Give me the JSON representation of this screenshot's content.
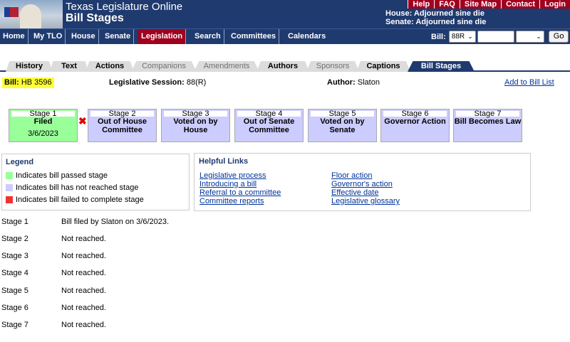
{
  "header": {
    "site_title": "Texas Legislature Online",
    "page_title": "Bill Stages",
    "top_links": [
      "Help",
      "FAQ",
      "Site Map",
      "Contact",
      "Login"
    ],
    "house_status": "House: Adjourned sine die",
    "senate_status": "Senate: Adjourned sine die"
  },
  "nav": {
    "items": [
      "Home",
      "My TLO",
      "House",
      "Senate",
      "Legislation",
      "Search",
      "Committees",
      "Calendars"
    ],
    "active": "Legislation",
    "bill_label": "Bill:",
    "session_value": "88R",
    "go_label": "Go"
  },
  "tabs": [
    "History",
    "Text",
    "Actions",
    "Companions",
    "Amendments",
    "Authors",
    "Sponsors",
    "Captions",
    "Bill Stages"
  ],
  "bill": {
    "label": "Bill:",
    "number": "HB 3596",
    "session_label": "Legislative Session:",
    "session_value": "88(R)",
    "author_label": "Author:",
    "author_value": "Slaton",
    "add_link": "Add to Bill List"
  },
  "stages": [
    {
      "header": "Stage 1",
      "name": "Filed",
      "date": "3/6/2023",
      "status": "passed"
    },
    {
      "header": "Stage 2",
      "name": "Out of House Committee",
      "date": "",
      "status": "not_reached"
    },
    {
      "header": "Stage 3",
      "name": "Voted on by House",
      "date": "",
      "status": "not_reached"
    },
    {
      "header": "Stage 4",
      "name": "Out of Senate Committee",
      "date": "",
      "status": "not_reached"
    },
    {
      "header": "Stage 5",
      "name": "Voted on by Senate",
      "date": "",
      "status": "not_reached"
    },
    {
      "header": "Stage 6",
      "name": "Governor Action",
      "date": "",
      "status": "not_reached"
    },
    {
      "header": "Stage 7",
      "name": "Bill Becomes Law",
      "date": "",
      "status": "not_reached"
    }
  ],
  "legend": {
    "title": "Legend",
    "items": [
      {
        "text": "Indicates bill passed stage",
        "color": "#99ff99"
      },
      {
        "text": "Indicates bill has not reached stage",
        "color": "#ccccff"
      },
      {
        "text": "Indicates bill failed to complete stage",
        "color": "#ee3333"
      }
    ]
  },
  "helpful_links": {
    "title": "Helpful Links",
    "left": [
      "Legislative process",
      "Introducing a bill",
      "Referral to a committee",
      "Committee reports"
    ],
    "right": [
      "Floor action",
      "Governor's action",
      "Effective date",
      "Legislative glossary"
    ]
  },
  "stage_details": [
    {
      "stage": "Stage 1",
      "text": "Bill filed by Slaton on 3/6/2023."
    },
    {
      "stage": "Stage 2",
      "text": "Not reached."
    },
    {
      "stage": "Stage 3",
      "text": "Not reached."
    },
    {
      "stage": "Stage 4",
      "text": "Not reached."
    },
    {
      "stage": "Stage 5",
      "text": "Not reached."
    },
    {
      "stage": "Stage 6",
      "text": "Not reached."
    },
    {
      "stage": "Stage 7",
      "text": "Not reached."
    }
  ],
  "colors": {
    "navy": "#1f3a6e",
    "red": "#a0001e",
    "passed": "#99ff99",
    "not_reached": "#ccccff",
    "highlight": "#ffff33"
  }
}
